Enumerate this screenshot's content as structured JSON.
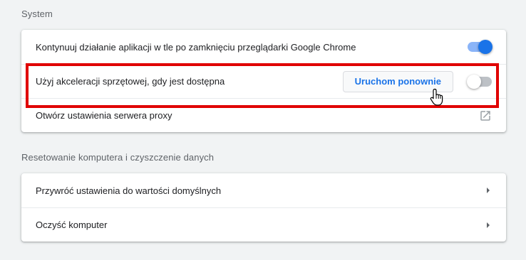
{
  "system_section": {
    "title": "System",
    "rows": [
      {
        "label": "Kontynuuj działanie aplikacji w tle po zamknięciu przeglądarki Google Chrome",
        "toggle_state": "on"
      },
      {
        "label": "Użyj akceleracji sprzętowej, gdy jest dostępna",
        "button_label": "Uruchom ponownie",
        "toggle_state": "off"
      },
      {
        "label": "Otwórz ustawienia serwera proxy",
        "icon": "external-link-icon"
      }
    ]
  },
  "reset_section": {
    "title": "Resetowanie komputera i czyszczenie danych",
    "rows": [
      {
        "label": "Przywróć ustawienia do wartości domyślnych",
        "icon": "chevron-right-icon"
      },
      {
        "label": "Oczyść komputer",
        "icon": "chevron-right-icon"
      }
    ]
  },
  "colors": {
    "accent": "#1a73e8",
    "highlight": "#e00000",
    "background": "#f1f3f4"
  }
}
